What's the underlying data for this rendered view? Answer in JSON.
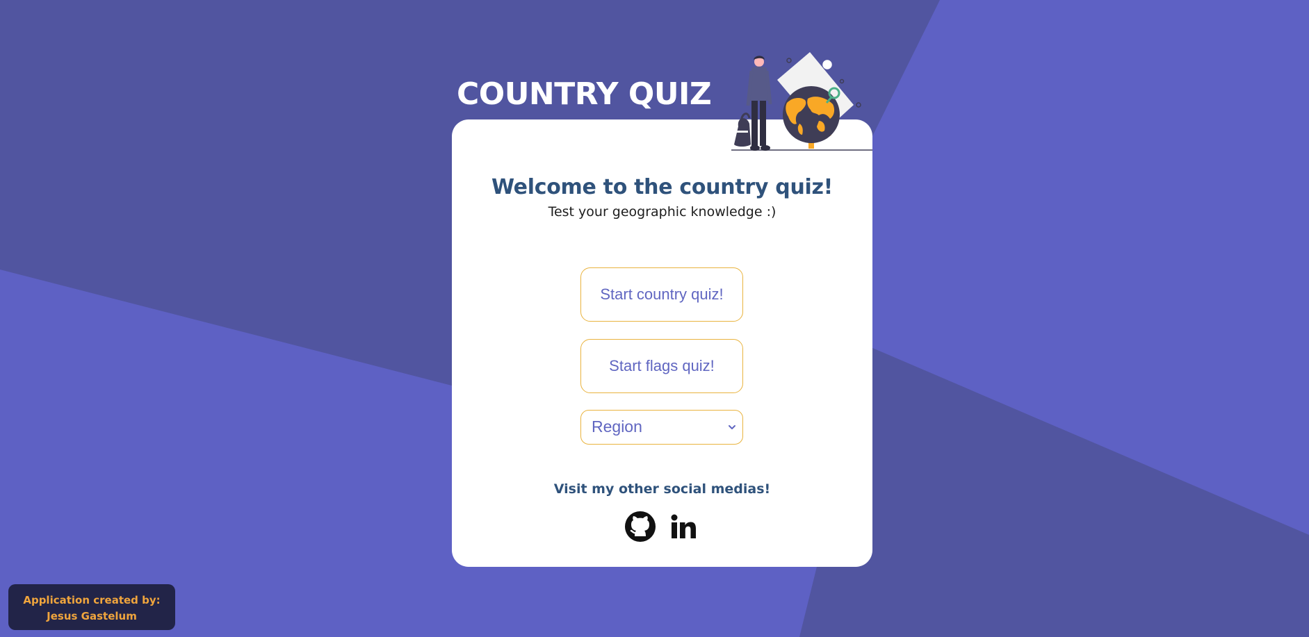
{
  "app": {
    "title": "COUNTRY QUIZ"
  },
  "card": {
    "welcome": "Welcome to the country quiz!",
    "subtitle": "Test your geographic knowledge :)",
    "buttons": {
      "country_quiz": "Start country quiz!",
      "flags_quiz": "Start flags quiz!"
    },
    "region_select": {
      "selected": "Region"
    },
    "social": {
      "title": "Visit my other social medias!",
      "icons": [
        "github-icon",
        "linkedin-icon"
      ]
    }
  },
  "credit": {
    "line1": "Application created by:",
    "line2": "Jesus Gastelum"
  },
  "colors": {
    "background_light": "#5e61c4",
    "background_dark": "#5155a0",
    "card": "#ffffff",
    "heading": "#2f527b",
    "button_text": "#6066c1",
    "button_border": "#e9b33e",
    "credit_bg": "#222448",
    "credit_text": "#f0a53d",
    "accent_orange": "#f9a826"
  }
}
